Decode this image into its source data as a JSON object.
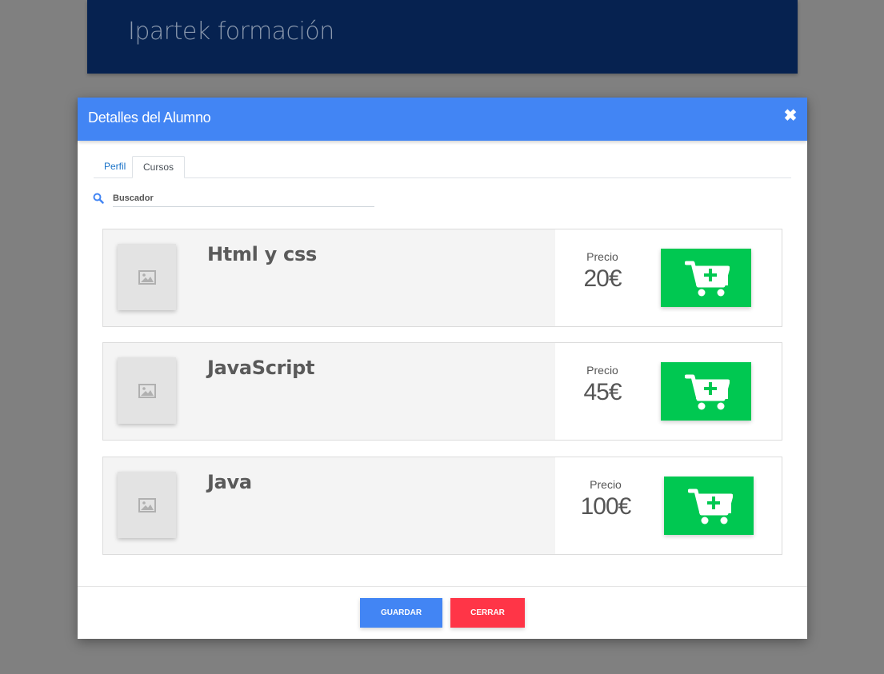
{
  "header": {
    "brand": "Ipartek formación"
  },
  "modal": {
    "title": "Detalles del Alumno",
    "close_icon": "close-icon",
    "tabs": [
      {
        "label": "Perfil",
        "active": false
      },
      {
        "label": "Cursos",
        "active": true
      }
    ],
    "search": {
      "placeholder": "Buscador",
      "value": "",
      "icon": "search-icon"
    },
    "courses": [
      {
        "name": "Html y css",
        "price_label": "Precio",
        "price": "20€",
        "image_icon": "image-placeholder-icon",
        "action_icon": "add-to-cart-icon"
      },
      {
        "name": "JavaScript",
        "price_label": "Precio",
        "price": "45€",
        "image_icon": "image-placeholder-icon",
        "action_icon": "add-to-cart-icon"
      },
      {
        "name": "Java",
        "price_label": "Precio",
        "price": "100€",
        "image_icon": "image-placeholder-icon",
        "action_icon": "add-to-cart-icon"
      }
    ],
    "footer": {
      "save_label": "Guardar",
      "close_label": "Cerrar"
    }
  },
  "colors": {
    "header_bg": "#062250",
    "modal_header_bg": "#4285f4",
    "cart_button": "#00c851",
    "save_button": "#4285f4",
    "close_button": "#ff3547",
    "overlay": "#808080"
  }
}
